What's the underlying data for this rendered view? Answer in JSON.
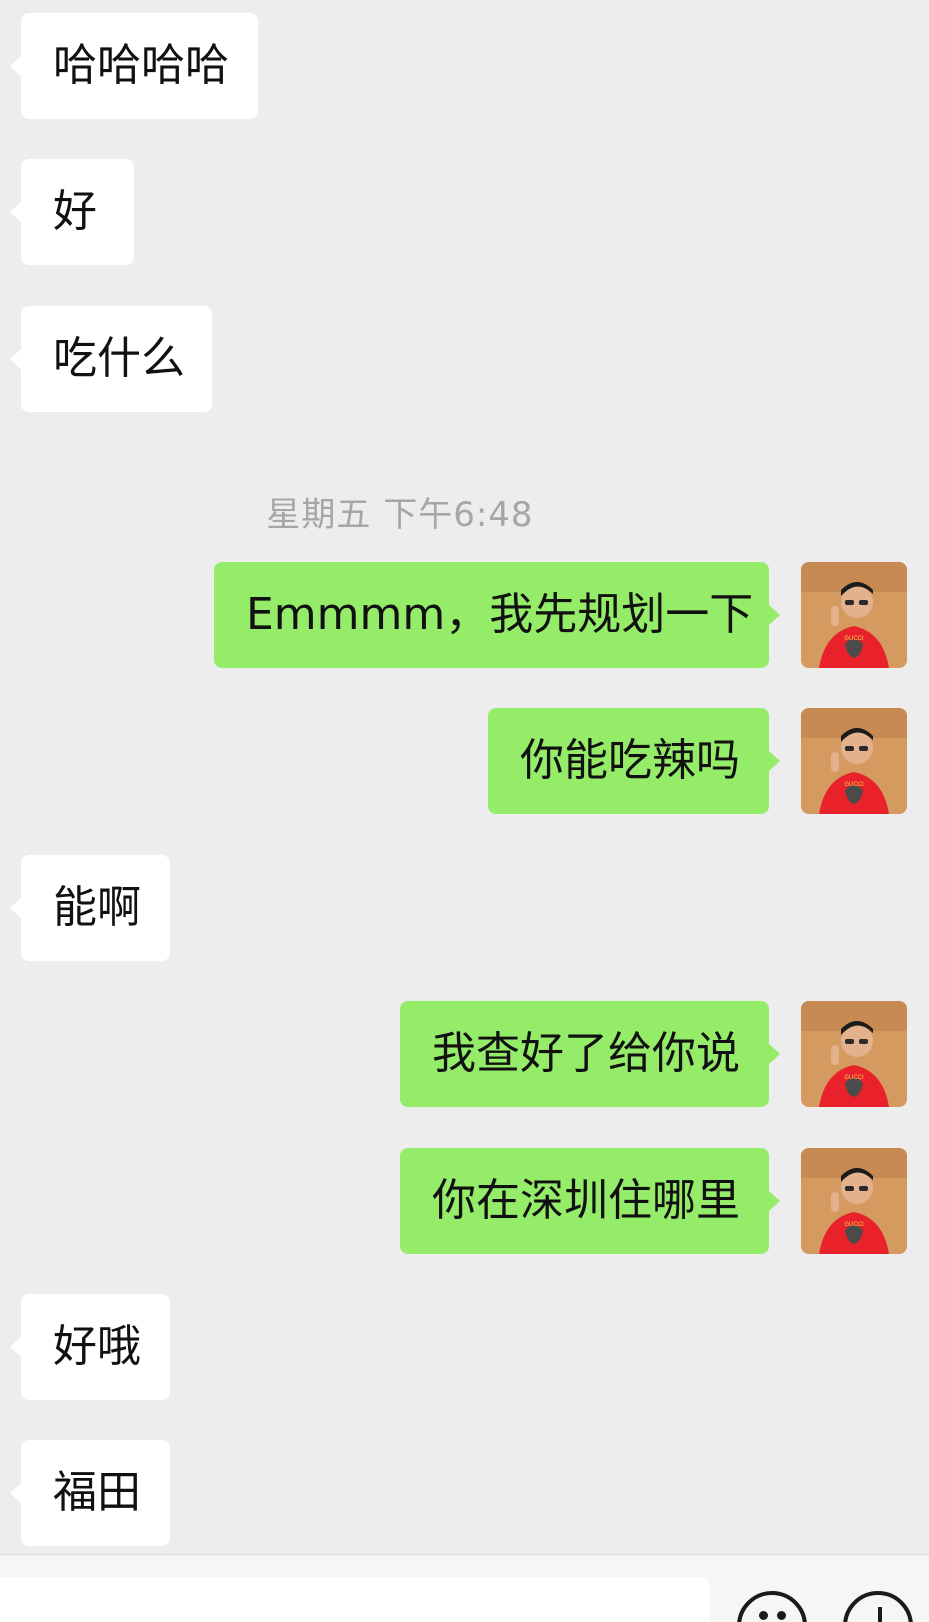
{
  "messages": [
    {
      "side": "in",
      "text": "哈哈哈哈"
    },
    {
      "side": "in",
      "text": "好"
    },
    {
      "side": "in",
      "text": "吃什么"
    },
    {
      "side": "out",
      "text": "Emmmm，我先规划一下"
    },
    {
      "side": "out",
      "text": "你能吃辣吗"
    },
    {
      "side": "in",
      "text": "能啊"
    },
    {
      "side": "out",
      "text": "我查好了给你说"
    },
    {
      "side": "out",
      "text": "你在深圳住哪里"
    },
    {
      "side": "in",
      "text": "好哦"
    },
    {
      "side": "in",
      "text": "福田"
    }
  ],
  "timestamp": "星期五 下午6:48",
  "avatar": {
    "shirt_text": "GUCCI"
  },
  "colors": {
    "background": "#ededed",
    "incoming_bubble": "#ffffff",
    "outgoing_bubble": "#95ec69",
    "timestamp_text": "#a6a6a6"
  },
  "input_bar": {
    "icons": [
      "emoji-icon",
      "plus-icon"
    ]
  }
}
